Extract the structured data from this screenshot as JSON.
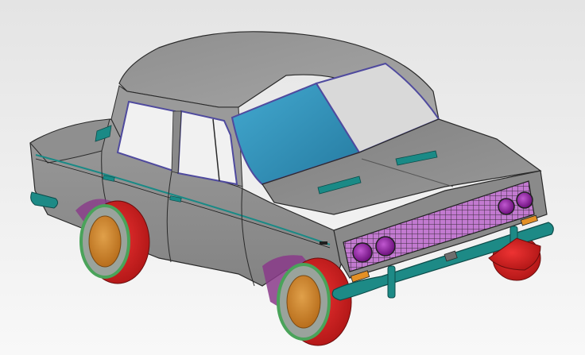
{
  "viewport": {
    "background": [
      "#e4e4e4",
      "#f8f8f8"
    ]
  },
  "model": {
    "subject": "sedan-car-cad-model",
    "colors": {
      "body": "#8c8c8c",
      "body_light": "#a3a3a3",
      "body_dark": "#6e6e6e",
      "edge": "#2a2a2a",
      "windshield": "#2f8fb6",
      "windshield_hi": "#47b0d6",
      "rear_window_outline": "#4f4a9e",
      "trim_teal": "#1a8a86",
      "bumper": "#1d8a86",
      "grille": "#b266c2",
      "grille_line": "#3a2a3a",
      "headlight": "#8a1f9a",
      "tire": "#d11e1e",
      "tire_dark": "#a81515",
      "rim_green": "#4aa35a",
      "rim_gray": "#9aa39c",
      "hub": "#c5802a",
      "wheel_arch_purple": "#8a3a8a",
      "orange_light": "#e39026"
    }
  }
}
